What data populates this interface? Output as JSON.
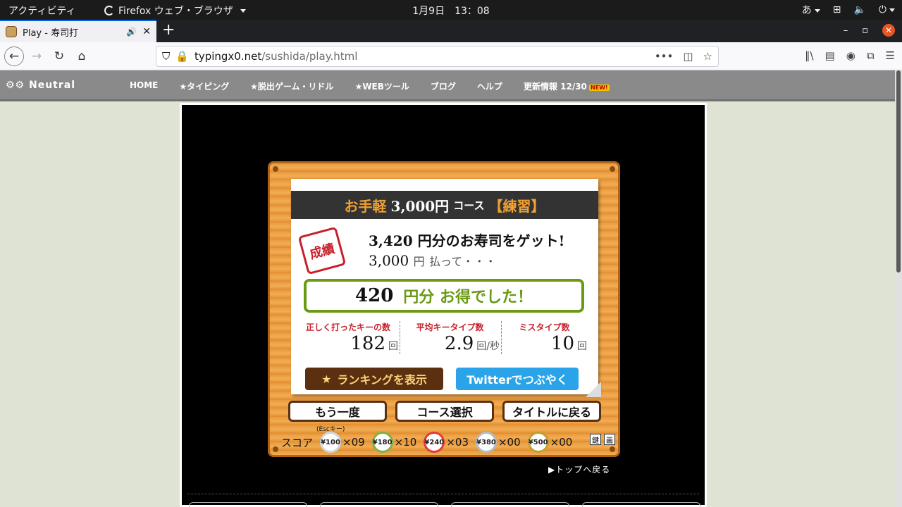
{
  "system": {
    "activities": "アクティビティ",
    "app_name": "Firefox ウェブ・ブラウザ",
    "clock": "1月9日　13：08",
    "ime": "あ",
    "network_icon": "network-icon",
    "volume_icon": "volume-icon",
    "power_icon": "power-icon"
  },
  "browser": {
    "tab_title": "Play - 寿司打",
    "new_tab": "+",
    "url_host": "typingx0.net",
    "url_path": "/sushida/play.html",
    "url_more": "•••",
    "minimize": "–",
    "maximize": "▫",
    "close": "✕"
  },
  "site": {
    "logo_text": "⚙⚙ Neutral",
    "menu": [
      "HOME",
      "★タイピング",
      "★脱出ゲーム・リドル",
      "★WEBツール",
      "ブログ",
      "ヘルプ",
      "更新情報 12/30"
    ],
    "new_badge": "NEW!"
  },
  "result": {
    "course_prefix": "お手軽",
    "course_amount": "3,000円",
    "course_suffix": "コース",
    "course_mode": "【練習】",
    "stamp": "成績",
    "got_line": "3,420 円分のお寿司をゲット!",
    "paid_amount": "3,000",
    "paid_unit": "円",
    "paid_tail": "払って・・・",
    "gain_amount": "420",
    "gain_text": "円分 お得でした！",
    "stats": [
      {
        "label": "正しく打ったキーの数",
        "value": "182",
        "unit": "回"
      },
      {
        "label": "平均キータイプ数",
        "value": "2.9",
        "unit": "回/秒"
      },
      {
        "label": "ミスタイプ数",
        "value": "10",
        "unit": "回"
      }
    ],
    "ranking_button": "ランキングを表示",
    "twitter_button": "Twitterでつぶやく"
  },
  "actions": {
    "retry": "もう一度",
    "course_select": "コース選択",
    "back_title": "タイトルに戻る",
    "esc_hint": "(Escキー)"
  },
  "score": {
    "label": "スコア",
    "plates": [
      {
        "price": "¥100",
        "count": "×09",
        "color": "#cfd8dc"
      },
      {
        "price": "¥180",
        "count": "×10",
        "color": "#7cb342"
      },
      {
        "price": "¥240",
        "count": "×03",
        "color": "#e53935"
      },
      {
        "price": "¥380",
        "count": "×00",
        "color": "#b0bec5"
      },
      {
        "price": "¥500",
        "count": "×00",
        "color": "#c0a030"
      }
    ],
    "icon_a": "鍵",
    "icon_b": "画"
  },
  "footer": {
    "top_link": "▶トップへ戻る"
  }
}
